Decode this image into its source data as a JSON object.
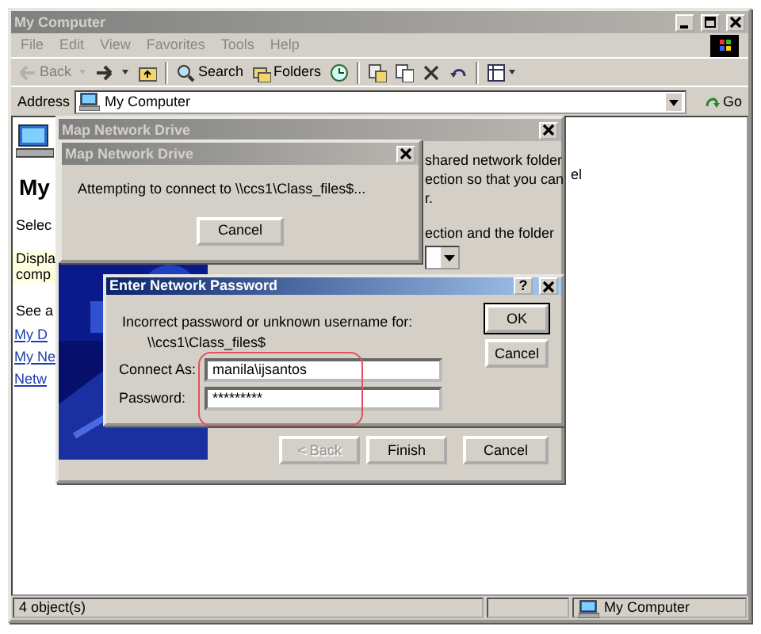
{
  "window": {
    "title": "My Computer",
    "active": false
  },
  "menu": [
    "File",
    "Edit",
    "View",
    "Favorites",
    "Tools",
    "Help"
  ],
  "toolbar": [
    {
      "kind": "back",
      "label": "Back",
      "disabled": true
    },
    {
      "kind": "dropdown",
      "disabled": true
    },
    {
      "kind": "forward",
      "disabled": false
    },
    {
      "kind": "dropdown",
      "disabled": false
    },
    {
      "kind": "up",
      "disabled": false
    },
    {
      "kind": "separator"
    },
    {
      "kind": "search",
      "label": "Search",
      "disabled": false
    },
    {
      "kind": "folders",
      "label": "Folders",
      "disabled": false
    },
    {
      "kind": "history",
      "disabled": false
    },
    {
      "kind": "separator"
    },
    {
      "kind": "move",
      "disabled": false
    },
    {
      "kind": "copy",
      "disabled": false
    },
    {
      "kind": "delete",
      "disabled": false
    },
    {
      "kind": "undo",
      "disabled": false
    },
    {
      "kind": "separator"
    },
    {
      "kind": "views",
      "disabled": false
    }
  ],
  "address": {
    "label": "Address",
    "value": "My Computer",
    "go": "Go"
  },
  "task_pane": {
    "title": "My",
    "texts": [
      "Selec",
      "Displa",
      "comp",
      "See a"
    ],
    "links": [
      "My D",
      "My Ne",
      "Netw"
    ]
  },
  "background_text": "el",
  "wizard": {
    "title": "Map Network Drive",
    "active": false,
    "lines": [
      "shared network folder",
      "ection so that you can",
      "r.",
      "ection and the folder"
    ],
    "buttons": [
      {
        "label": "< Back",
        "disabled": true
      },
      {
        "label": "Finish",
        "disabled": false
      },
      {
        "label": "Cancel",
        "disabled": false
      }
    ]
  },
  "progress": {
    "title": "Map Network Drive",
    "active": false,
    "message": "Attempting to connect to \\\\ccs1\\Class_files$...",
    "button": "Cancel"
  },
  "password_dialog": {
    "title": "Enter Network Password",
    "active": true,
    "help": "?",
    "message": "Incorrect password or unknown username for:",
    "share": "\\\\ccs1\\Class_files$",
    "fields": [
      {
        "label": "Connect As:",
        "value": "manila\\ijsantos"
      },
      {
        "label": "Password:",
        "value": "*********"
      }
    ],
    "buttons": [
      "OK",
      "Cancel"
    ]
  },
  "status_bar": {
    "text": "4 object(s)",
    "zone": "My Computer"
  }
}
